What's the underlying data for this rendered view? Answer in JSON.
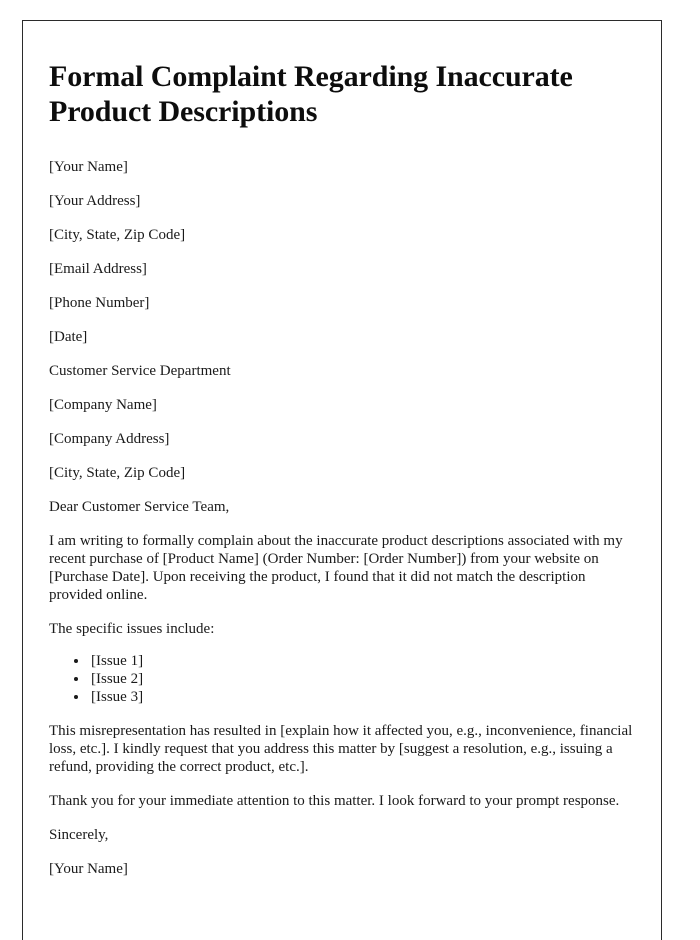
{
  "document": {
    "title": "Formal Complaint Regarding Inaccurate Product Descriptions",
    "sender_block": [
      "[Your Name]",
      "[Your Address]",
      "[City, State, Zip Code]",
      "[Email Address]",
      "[Phone Number]",
      "[Date]"
    ],
    "recipient_block": [
      "Customer Service Department",
      "[Company Name]",
      "[Company Address]",
      "[City, State, Zip Code]"
    ],
    "salutation": "Dear Customer Service Team,",
    "body": {
      "opening_paragraph": "I am writing to formally complain about the inaccurate product descriptions associated with my recent purchase of [Product Name] (Order Number: [Order Number]) from your website on [Purchase Date]. Upon receiving the product, I found that it did not match the description provided online.",
      "issues_intro": "The specific issues include:",
      "issues": [
        "[Issue 1]",
        "[Issue 2]",
        "[Issue 3]"
      ],
      "impact_paragraph": "This misrepresentation has resulted in [explain how it affected you, e.g., inconvenience, financial loss, etc.]. I kindly request that you address this matter by [suggest a resolution, e.g., issuing a refund, providing the correct product, etc.].",
      "closing_paragraph": "Thank you for your immediate attention to this matter. I look forward to your prompt response."
    },
    "closing": "Sincerely,",
    "signature_name": "[Your Name]"
  }
}
